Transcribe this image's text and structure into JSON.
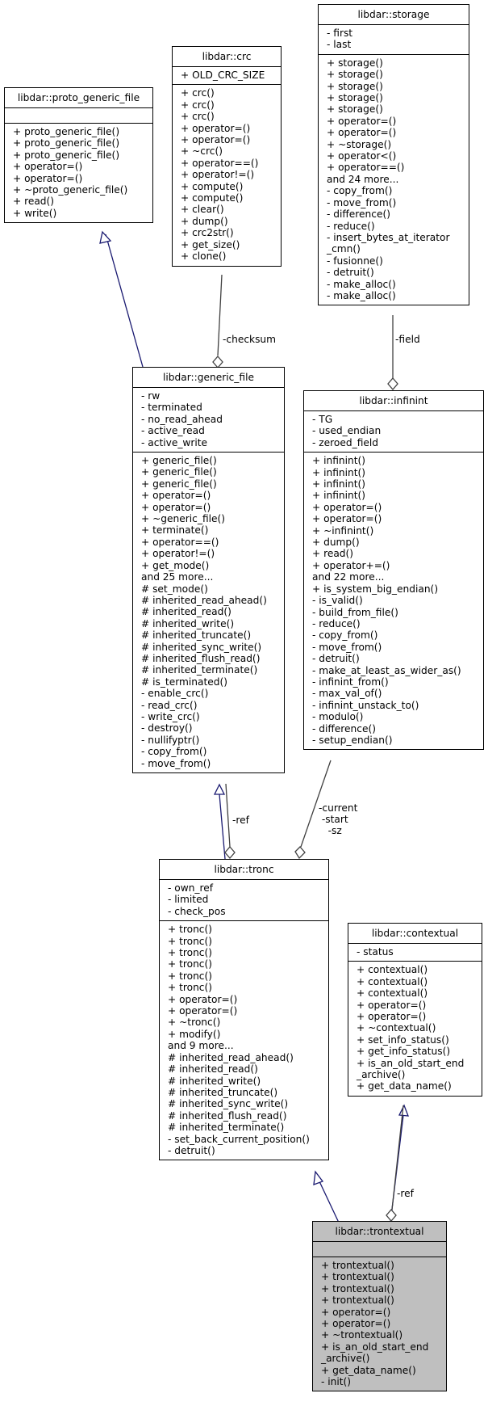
{
  "classes": {
    "proto_generic_file": {
      "name": "libdar::proto_generic_file",
      "attributes": [],
      "methods": [
        "+ proto_generic_file()",
        "+ proto_generic_file()",
        "+ proto_generic_file()",
        "+ operator=()",
        "+ operator=()",
        "+ ~proto_generic_file()",
        "+ read()",
        "+ write()"
      ]
    },
    "crc": {
      "name": "libdar::crc",
      "attributes": [
        "+ OLD_CRC_SIZE"
      ],
      "methods": [
        "+ crc()",
        "+ crc()",
        "+ crc()",
        "+ operator=()",
        "+ operator=()",
        "+ ~crc()",
        "+ operator==()",
        "+ operator!=()",
        "+ compute()",
        "+ compute()",
        "+ clear()",
        "+ dump()",
        "+ crc2str()",
        "+ get_size()",
        "+ clone()"
      ]
    },
    "storage": {
      "name": "libdar::storage",
      "attributes": [
        "- first",
        "- last"
      ],
      "methods": [
        "+ storage()",
        "+ storage()",
        "+ storage()",
        "+ storage()",
        "+ storage()",
        "+ operator=()",
        "+ operator=()",
        "+ ~storage()",
        "+ operator<()",
        "+ operator==()",
        "and 24 more...",
        "- copy_from()",
        "- move_from()",
        "- difference()",
        "- reduce()",
        "- insert_bytes_at_iterator",
        "_cmn()",
        "- fusionne()",
        "- detruit()",
        "- make_alloc()",
        "- make_alloc()"
      ]
    },
    "generic_file": {
      "name": "libdar::generic_file",
      "attributes": [
        "- rw",
        "- terminated",
        "- no_read_ahead",
        "- active_read",
        "- active_write"
      ],
      "methods": [
        "+ generic_file()",
        "+ generic_file()",
        "+ generic_file()",
        "+ operator=()",
        "+ operator=()",
        "+ ~generic_file()",
        "+ terminate()",
        "+ operator==()",
        "+ operator!=()",
        "+ get_mode()",
        "and 25 more...",
        "# set_mode()",
        "# inherited_read_ahead()",
        "# inherited_read()",
        "# inherited_write()",
        "# inherited_truncate()",
        "# inherited_sync_write()",
        "# inherited_flush_read()",
        "# inherited_terminate()",
        "# is_terminated()",
        "- enable_crc()",
        "- read_crc()",
        "- write_crc()",
        "- destroy()",
        "- nullifyptr()",
        "- copy_from()",
        "- move_from()"
      ]
    },
    "infinint": {
      "name": "libdar::infinint",
      "attributes": [
        "- TG",
        "- used_endian",
        "- zeroed_field"
      ],
      "methods": [
        "+ infinint()",
        "+ infinint()",
        "+ infinint()",
        "+ infinint()",
        "+ operator=()",
        "+ operator=()",
        "+ ~infinint()",
        "+ dump()",
        "+ read()",
        "+ operator+=()",
        "and 22 more...",
        "+ is_system_big_endian()",
        "- is_valid()",
        "- build_from_file()",
        "- reduce()",
        "- copy_from()",
        "- move_from()",
        "- detruit()",
        "- make_at_least_as_wider_as()",
        "- infinint_from()",
        "- max_val_of()",
        "- infinint_unstack_to()",
        "- modulo()",
        "- difference()",
        "- setup_endian()"
      ]
    },
    "tronc": {
      "name": "libdar::tronc",
      "attributes": [
        "- own_ref",
        "- limited",
        "- check_pos"
      ],
      "methods": [
        "+ tronc()",
        "+ tronc()",
        "+ tronc()",
        "+ tronc()",
        "+ tronc()",
        "+ tronc()",
        "+ operator=()",
        "+ operator=()",
        "+ ~tronc()",
        "+ modify()",
        "and 9 more...",
        "# inherited_read_ahead()",
        "# inherited_read()",
        "# inherited_write()",
        "# inherited_truncate()",
        "# inherited_sync_write()",
        "# inherited_flush_read()",
        "# inherited_terminate()",
        "- set_back_current_position()",
        "- detruit()"
      ]
    },
    "contextual": {
      "name": "libdar::contextual",
      "attributes": [
        "- status"
      ],
      "methods": [
        "+ contextual()",
        "+ contextual()",
        "+ contextual()",
        "+ operator=()",
        "+ operator=()",
        "+ ~contextual()",
        "+ set_info_status()",
        "+ get_info_status()",
        "+ is_an_old_start_end",
        "_archive()",
        "+ get_data_name()"
      ]
    },
    "trontextual": {
      "name": "libdar::trontextual",
      "attributes": [],
      "methods": [
        "+ trontextual()",
        "+ trontextual()",
        "+ trontextual()",
        "+ trontextual()",
        "+ operator=()",
        "+ operator=()",
        "+ ~trontextual()",
        "+ is_an_old_start_end",
        "_archive()",
        "+ get_data_name()",
        "- init()"
      ]
    }
  },
  "edge_labels": {
    "checksum": "-checksum",
    "field": "-field",
    "ref_generic": "-ref",
    "tronc_members": "-current\n -start\n   -sz",
    "ref_contextual": "-ref"
  },
  "colors": {
    "inheritance": "#191970",
    "composition": "#404040",
    "focus_fill": "#bfbfbf"
  }
}
